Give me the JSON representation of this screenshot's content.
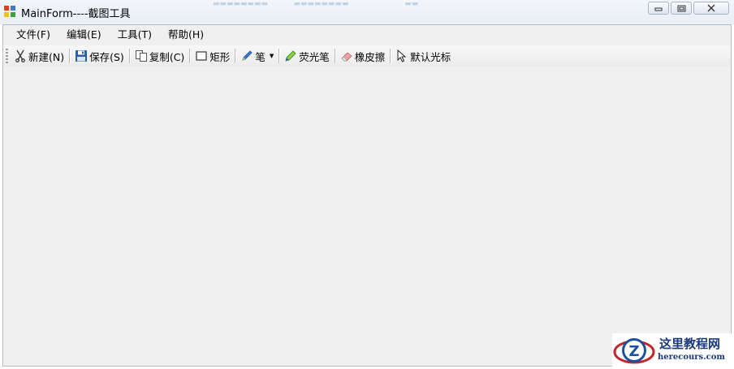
{
  "window": {
    "title": "MainForm----截图工具",
    "buttons": {
      "minimize": "minimize-icon",
      "maximize": "restore-icon",
      "close": "close-icon"
    }
  },
  "menu": [
    {
      "label": "文件(F)"
    },
    {
      "label": "编辑(E)"
    },
    {
      "label": "工具(T)"
    },
    {
      "label": "帮助(H)"
    }
  ],
  "toolbar": {
    "new_label": "新建(N)",
    "save_label": "保存(S)",
    "copy_label": "复制(C)",
    "rect_label": "矩形",
    "pen_label": "笔",
    "highlighter_label": "荧光笔",
    "eraser_label": "橡皮擦",
    "cursor_label": "默认光标"
  },
  "watermark": {
    "title": "这里教程网",
    "subtitle": "herecours.com"
  },
  "colors": {
    "client_bg": "#f0f0f0",
    "watermark_text": "#1a3a7a",
    "watermark_accent": "#c0282d"
  }
}
